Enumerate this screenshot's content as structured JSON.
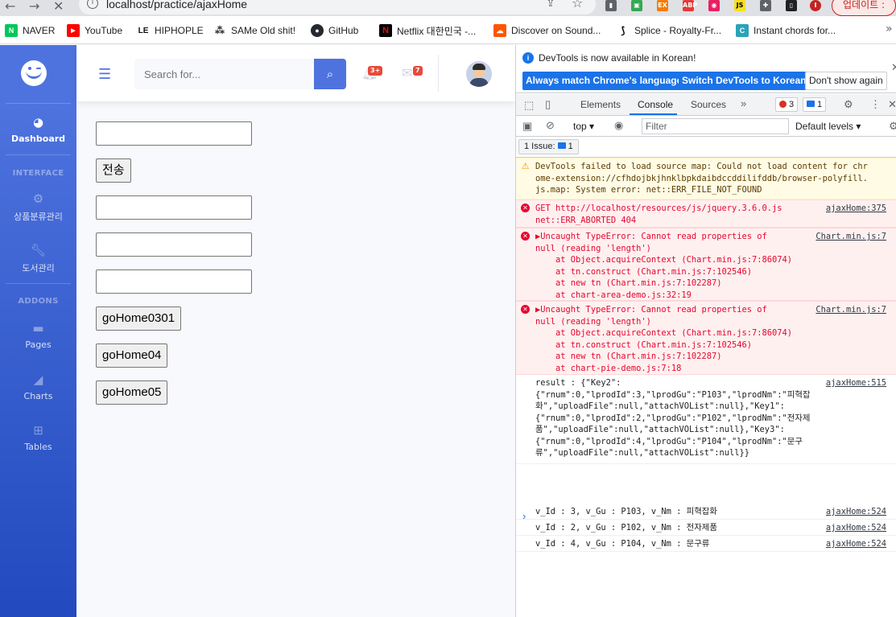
{
  "browser": {
    "url": "localhost/practice/ajaxHome",
    "update_label": "업데이트 :",
    "bookmarks": [
      {
        "label": "NAVER",
        "icon": "naver-icon",
        "color": "#03c75a",
        "glyph": "N"
      },
      {
        "label": "YouTube",
        "icon": "youtube-icon",
        "color": "#ff0000",
        "glyph": "▶"
      },
      {
        "label": "HIPHOPLE",
        "icon": "hiphople-icon",
        "color": "#111111",
        "glyph": "LE"
      },
      {
        "label": "SAMe Old shit!",
        "icon": "same-icon",
        "color": "#333333",
        "glyph": "⁂"
      },
      {
        "label": "GitHub",
        "icon": "github-icon",
        "color": "#24292f",
        "glyph": "●"
      },
      {
        "label": "Netflix 대한민국 -...",
        "icon": "netflix-icon",
        "color": "#e50914",
        "glyph": "N"
      },
      {
        "label": "Discover on Sound...",
        "icon": "soundcloud-icon",
        "color": "#ff5500",
        "glyph": "☁"
      },
      {
        "label": "Splice - Royalty-Fr...",
        "icon": "splice-icon",
        "color": "#000000",
        "glyph": "S"
      },
      {
        "label": "Instant chords for...",
        "icon": "chords-icon",
        "color": "#2aa3b8",
        "glyph": "C"
      }
    ]
  },
  "sidebar": {
    "items": [
      {
        "label": "Dashboard",
        "icon": "tachometer-icon"
      },
      {
        "label": "상품분류관리",
        "icon": "cog-icon"
      },
      {
        "label": "도서관리",
        "icon": "wrench-icon"
      },
      {
        "label": "Pages",
        "icon": "folder-icon"
      },
      {
        "label": "Charts",
        "icon": "chart-area-icon"
      },
      {
        "label": "Tables",
        "icon": "table-icon"
      }
    ],
    "headings": [
      "INTERFACE",
      "ADDONS"
    ]
  },
  "topbar": {
    "search_placeholder": "Search for...",
    "alerts_badge": "3+",
    "messages_badge": "7"
  },
  "form": {
    "send_label": "전송",
    "buttons": [
      "goHome0301",
      "goHome04",
      "goHome05"
    ]
  },
  "devtools": {
    "info_text": "DevTools is now available in Korean!",
    "btn_match": "Always match Chrome's language",
    "btn_switch": "Switch DevTools to Korean",
    "btn_dont": "Don't show again",
    "tabs": [
      "Elements",
      "Console",
      "Sources"
    ],
    "error_count": "3",
    "info_count": "1",
    "context": "top",
    "filter_placeholder": "Filter",
    "levels": "Default levels",
    "issues": "1 Issue:",
    "issues_count": "1",
    "logs": [
      {
        "type": "warn",
        "lines": [
          "DevTools failed to load source map: Could not load content for chr",
          "ome-extension://cfhdojbkjhnklbpkdaibdccddilifddb/browser-polyfill.",
          "js.map: System error: net::ERR_FILE_NOT_FOUND"
        ],
        "src": ""
      },
      {
        "type": "err",
        "lines": [
          "GET http://localhost/resources/js/jquery.3.6.0.js",
          "net::ERR_ABORTED 404"
        ],
        "src": "ajaxHome:375"
      },
      {
        "type": "err",
        "lines": [
          "▶Uncaught TypeError: Cannot read properties of",
          "null (reading 'length')",
          "    at Object.acquireContext (Chart.min.js:7:86074)",
          "    at tn.construct (Chart.min.js:7:102546)",
          "    at new tn (Chart.min.js:7:102287)",
          "    at chart-area-demo.js:32:19"
        ],
        "src": "Chart.min.js:7"
      },
      {
        "type": "err",
        "lines": [
          "▶Uncaught TypeError: Cannot read properties of",
          "null (reading 'length')",
          "    at Object.acquireContext (Chart.min.js:7:86074)",
          "    at tn.construct (Chart.min.js:7:102546)",
          "    at new tn (Chart.min.js:7:102287)",
          "    at chart-pie-demo.js:7:18"
        ],
        "src": "Chart.min.js:7"
      },
      {
        "type": "log",
        "lines": [
          "result : {\"Key2\":",
          "{\"rnum\":0,\"lprodId\":3,\"lprodGu\":\"P103\",\"lprodNm\":\"피혁잡",
          "화\",\"uploadFile\":null,\"attachVOList\":null},\"Key1\":",
          "{\"rnum\":0,\"lprodId\":2,\"lprodGu\":\"P102\",\"lprodNm\":\"전자제",
          "품\",\"uploadFile\":null,\"attachVOList\":null},\"Key3\":",
          "{\"rnum\":0,\"lprodId\":4,\"lprodGu\":\"P104\",\"lprodNm\":\"문구",
          "류\",\"uploadFile\":null,\"attachVOList\":null}}"
        ],
        "src": "ajaxHome:515"
      },
      {
        "type": "log",
        "lines": [
          "v_Id : 3, v_Gu : P103, v_Nm : 피혁잡화"
        ],
        "src": "ajaxHome:524"
      },
      {
        "type": "log",
        "lines": [
          "v_Id : 2, v_Gu : P102, v_Nm : 전자제품"
        ],
        "src": "ajaxHome:524"
      },
      {
        "type": "log",
        "lines": [
          "v_Id : 4, v_Gu : P104, v_Nm : 문구류"
        ],
        "src": "ajaxHome:524"
      }
    ]
  }
}
